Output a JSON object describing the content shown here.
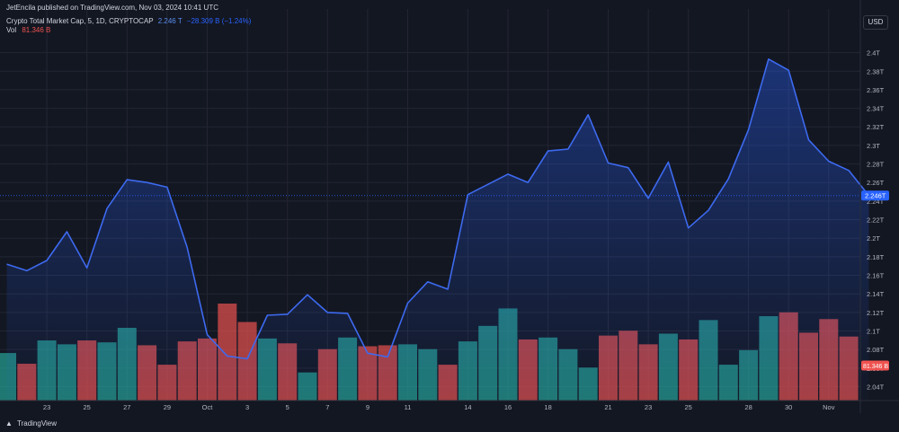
{
  "header": {
    "published": "JetEncila published on TradingView.com, Nov 03, 2024 10:41 UTC",
    "symbol": "Crypto Total Market Cap, 5, 1D, CRYPTOCAP",
    "last_value": "2.246 T",
    "change": "−28.309 B (−1.24%)",
    "vol_label": "Vol",
    "vol_value": "81.346 B"
  },
  "currency": "USD",
  "branding": "TradingView",
  "colors": {
    "background": "#131722",
    "line": "#3d6af0",
    "up": "#26a69a",
    "down": "#ef5350",
    "price_label": "#2962ff"
  },
  "chart_data": {
    "type": "line",
    "y_unit": "T (USD)",
    "ylim": [
      2.025,
      2.418
    ],
    "y_ticks": [
      "2.4T",
      "2.38T",
      "2.36T",
      "2.34T",
      "2.32T",
      "2.3T",
      "2.28T",
      "2.26T",
      "2.24T",
      "2.22T",
      "2.2T",
      "2.18T",
      "2.16T",
      "2.14T",
      "2.12T",
      "2.1T",
      "2.08T",
      "2.06T",
      "2.04T"
    ],
    "y_tick_values": [
      2.4,
      2.38,
      2.36,
      2.34,
      2.32,
      2.3,
      2.28,
      2.26,
      2.24,
      2.22,
      2.2,
      2.18,
      2.16,
      2.14,
      2.12,
      2.1,
      2.08,
      2.06,
      2.04
    ],
    "x_ticks": [
      {
        "label": "23",
        "index": 2
      },
      {
        "label": "25",
        "index": 4
      },
      {
        "label": "27",
        "index": 6
      },
      {
        "label": "29",
        "index": 8
      },
      {
        "label": "Oct",
        "index": 10
      },
      {
        "label": "3",
        "index": 12
      },
      {
        "label": "5",
        "index": 14
      },
      {
        "label": "7",
        "index": 16
      },
      {
        "label": "9",
        "index": 18
      },
      {
        "label": "11",
        "index": 20
      },
      {
        "label": "14",
        "index": 23
      },
      {
        "label": "16",
        "index": 25
      },
      {
        "label": "18",
        "index": 27
      },
      {
        "label": "21",
        "index": 30
      },
      {
        "label": "23",
        "index": 32
      },
      {
        "label": "25",
        "index": 34
      },
      {
        "label": "28",
        "index": 37
      },
      {
        "label": "30",
        "index": 39
      },
      {
        "label": "Nov",
        "index": 41
      }
    ],
    "series": [
      {
        "values": [
          2.172,
          2.165,
          2.176,
          2.207,
          2.168,
          2.232,
          2.263,
          2.26,
          2.255,
          2.19,
          2.096,
          2.073,
          2.07,
          2.117,
          2.118,
          2.139,
          2.12,
          2.119,
          2.076,
          2.072,
          2.13,
          2.153,
          2.145,
          2.247,
          2.258,
          2.269,
          2.26,
          2.294,
          2.296,
          2.333,
          2.281,
          2.276,
          2.243,
          2.282,
          2.211,
          2.23,
          2.264,
          2.317,
          2.393,
          2.381,
          2.306,
          2.283,
          2.273,
          2.246
        ]
      }
    ],
    "volume": {
      "label": "Vol",
      "last": "81.346 B",
      "bars": [
        {
          "h": 0.49,
          "up": true
        },
        {
          "h": 0.38,
          "up": false
        },
        {
          "h": 0.62,
          "up": true
        },
        {
          "h": 0.58,
          "up": true
        },
        {
          "h": 0.62,
          "up": false
        },
        {
          "h": 0.6,
          "up": true
        },
        {
          "h": 0.75,
          "up": true
        },
        {
          "h": 0.57,
          "up": false
        },
        {
          "h": 0.37,
          "up": false
        },
        {
          "h": 0.61,
          "up": false
        },
        {
          "h": 0.64,
          "up": false
        },
        {
          "h": 1.0,
          "up": false
        },
        {
          "h": 0.81,
          "up": false
        },
        {
          "h": 0.64,
          "up": true
        },
        {
          "h": 0.59,
          "up": false
        },
        {
          "h": 0.29,
          "up": true
        },
        {
          "h": 0.53,
          "up": false
        },
        {
          "h": 0.65,
          "up": true
        },
        {
          "h": 0.56,
          "up": false
        },
        {
          "h": 0.57,
          "up": false
        },
        {
          "h": 0.58,
          "up": true
        },
        {
          "h": 0.53,
          "up": true
        },
        {
          "h": 0.37,
          "up": false
        },
        {
          "h": 0.61,
          "up": true
        },
        {
          "h": 0.77,
          "up": true
        },
        {
          "h": 0.95,
          "up": true
        },
        {
          "h": 0.63,
          "up": false
        },
        {
          "h": 0.65,
          "up": true
        },
        {
          "h": 0.53,
          "up": true
        },
        {
          "h": 0.34,
          "up": true
        },
        {
          "h": 0.67,
          "up": false
        },
        {
          "h": 0.72,
          "up": false
        },
        {
          "h": 0.58,
          "up": false
        },
        {
          "h": 0.69,
          "up": true
        },
        {
          "h": 0.63,
          "up": false
        },
        {
          "h": 0.83,
          "up": true
        },
        {
          "h": 0.37,
          "up": true
        },
        {
          "h": 0.52,
          "up": true
        },
        {
          "h": 0.87,
          "up": true
        },
        {
          "h": 0.91,
          "up": false
        },
        {
          "h": 0.7,
          "up": false
        },
        {
          "h": 0.84,
          "up": false
        },
        {
          "h": 0.66,
          "up": false
        }
      ]
    },
    "grid": true,
    "last_price_label": "2.246T",
    "volume_label": "81.346 B"
  }
}
